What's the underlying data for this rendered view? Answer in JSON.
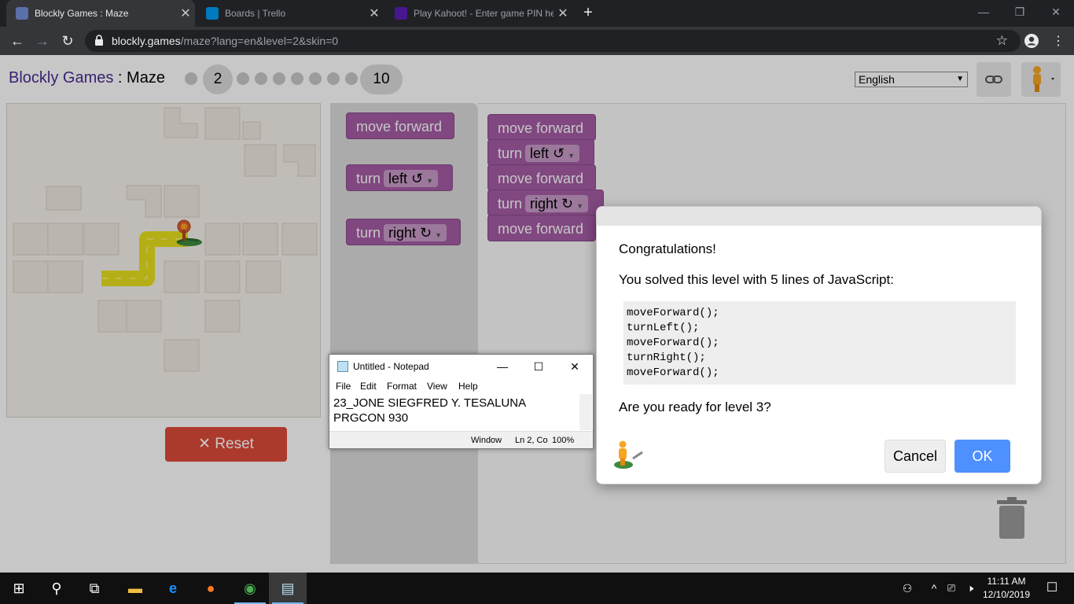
{
  "browser": {
    "tabs": [
      {
        "title": "Blockly Games : Maze",
        "active": true
      },
      {
        "title": "Boards | Trello",
        "active": false
      },
      {
        "title": "Play Kahoot! - Enter game PIN he",
        "active": false
      }
    ],
    "url_domain": "blockly.games",
    "url_path": "/maze?lang=en&level=2&skin=0"
  },
  "header": {
    "app_name": "Blockly Games",
    "separator": " : ",
    "page_name": "Maze",
    "current_level": "2",
    "max_level": "10",
    "language": "English"
  },
  "maze": {
    "reset_label": "Reset"
  },
  "toolbox": {
    "move_forward": "move forward",
    "turn": "turn",
    "left": "left ↺",
    "right": "right ↻"
  },
  "workspace": {
    "move_forward": "move forward",
    "turn": "turn",
    "left": "left ↺",
    "right": "right ↻"
  },
  "notepad": {
    "title": "Untitled - Notepad",
    "menu": [
      "File",
      "Edit",
      "Format",
      "View",
      "Help"
    ],
    "text": "23_JONE SIEGFRED Y. TESALUNA\nPRGCON 930",
    "status_window": "Window",
    "status_position": "Ln 2, Co",
    "status_zoom": "100%"
  },
  "dialog": {
    "congrats": "Congratulations!",
    "solved": "You solved this level with 5 lines of JavaScript:",
    "code": [
      "moveForward();",
      "turnLeft();",
      "moveForward();",
      "turnRight();",
      "moveForward();"
    ],
    "ready": "Are you ready for level 3?",
    "cancel": "Cancel",
    "ok": "OK"
  },
  "taskbar": {
    "time": "11:11 AM",
    "date": "12/10/2019"
  },
  "colors": {
    "block_purple": "#a55ba5",
    "reset_red": "#dd4b39",
    "ok_blue": "#4d90fe",
    "path_yellow": "#e8e01e"
  }
}
